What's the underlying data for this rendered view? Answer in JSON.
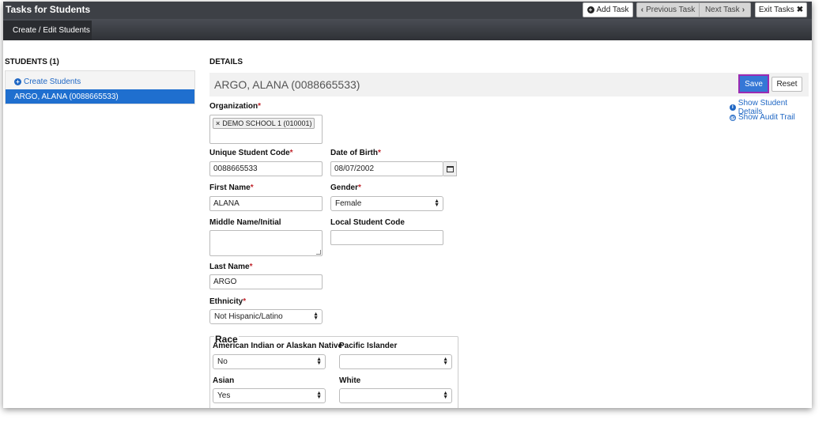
{
  "header": {
    "title": "Tasks for Students",
    "add_task": "Add Task",
    "previous_task": "Previous Task",
    "next_task": "Next Task",
    "exit_tasks": "Exit Tasks"
  },
  "tabs": [
    {
      "label": "Create / Edit Students",
      "active": true
    }
  ],
  "students_panel": {
    "heading": "STUDENTS (1)",
    "create_link": "Create Students",
    "items": [
      {
        "label": "ARGO, ALANA (0088665533)",
        "selected": true
      }
    ]
  },
  "details": {
    "heading": "DETAILS",
    "student_name": "ARGO, ALANA (0088665533)",
    "save_label": "Save",
    "reset_label": "Reset",
    "show_student_details": "Show Student Details",
    "show_audit_trail": "Show Audit Trail",
    "accent_color": "#3577d6",
    "highlight_color": "#9b2bb3",
    "required_marker": "*"
  },
  "form": {
    "organization": {
      "label": "Organization",
      "required": true,
      "tag": "DEMO SCHOOL 1 (010001)"
    },
    "unique_student_code": {
      "label": "Unique Student Code",
      "required": true,
      "value": "0088665533"
    },
    "date_of_birth": {
      "label": "Date of Birth",
      "required": true,
      "value": "08/07/2002"
    },
    "first_name": {
      "label": "First Name",
      "required": true,
      "value": "ALANA"
    },
    "gender": {
      "label": "Gender",
      "required": true,
      "value": "Female"
    },
    "middle_name": {
      "label": "Middle Name/Initial",
      "value": ""
    },
    "local_student_code": {
      "label": "Local Student Code",
      "value": ""
    },
    "last_name": {
      "label": "Last Name",
      "required": true,
      "value": "ARGO"
    },
    "ethnicity": {
      "label": "Ethnicity",
      "required": true,
      "value": "Not Hispanic/Latino"
    },
    "race": {
      "legend": "Race",
      "american_indian": {
        "label": "American Indian or Alaskan Native",
        "value": "No"
      },
      "pacific_islander": {
        "label": "Pacific Islander",
        "value": ""
      },
      "asian": {
        "label": "Asian",
        "value": "Yes"
      },
      "white": {
        "label": "White",
        "value": ""
      }
    }
  }
}
